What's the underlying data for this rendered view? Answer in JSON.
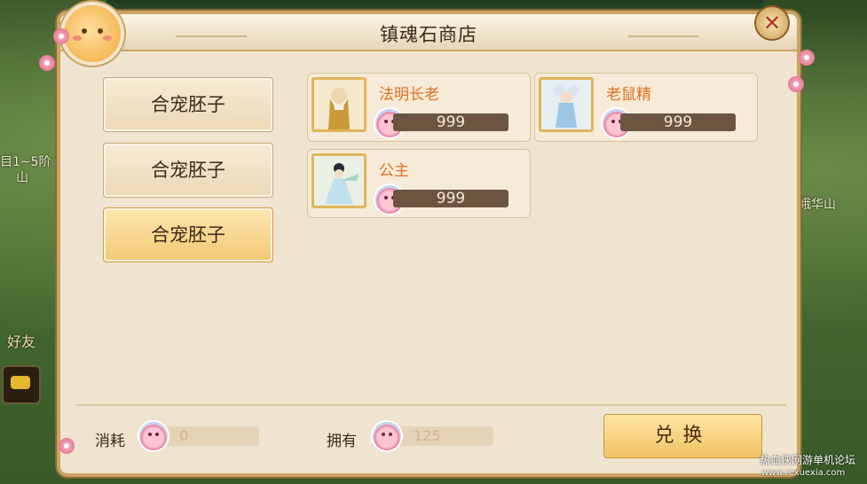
{
  "title": "镇魂石商店",
  "close_symbol": "✕",
  "tabs": [
    {
      "label": "合宠胚子",
      "active": false
    },
    {
      "label": "合宠胚子",
      "active": false
    },
    {
      "label": "合宠胚子",
      "active": true
    }
  ],
  "items": [
    {
      "name": "法明长老",
      "price": "999",
      "portrait_icon": "elder-monk-portrait"
    },
    {
      "name": "老鼠精",
      "price": "999",
      "portrait_icon": "mouse-spirit-portrait"
    },
    {
      "name": "公主",
      "price": "999",
      "portrait_icon": "princess-portrait"
    }
  ],
  "footer": {
    "cost_label": "消耗",
    "cost_value": "0",
    "owned_label": "拥有",
    "owned_value": "125",
    "exchange_label": "兑换"
  },
  "background": {
    "left_text_1": "目1~5阶",
    "left_text_2": "山",
    "right_text": "峨华山",
    "friends_label": "好友"
  },
  "watermark": {
    "line1": "热血侠网游单机论坛",
    "line2": "www.rexuexia.com"
  },
  "colors": {
    "item_name": "#e0701e",
    "active_tab": "#f3c874",
    "frame": "#c9a464"
  }
}
